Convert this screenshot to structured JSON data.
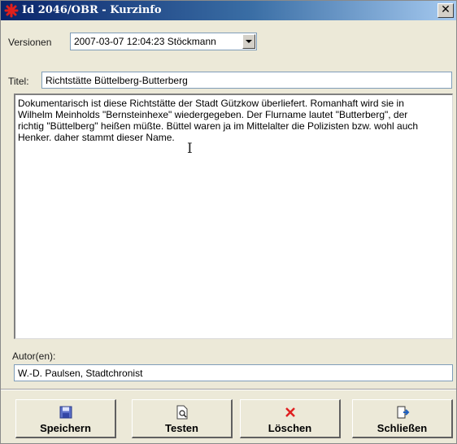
{
  "window": {
    "title": "Id 2046/OBR - Kurzinfo",
    "close_glyph": "✕",
    "app_icon": "red-star-icon",
    "accent": "#0a246a"
  },
  "version": {
    "label": "Versionen",
    "selected": "2007-03-07 12:04:23 Stöckmann"
  },
  "titel": {
    "label": "Titel:",
    "value": "Richtstätte Büttelberg-Butterberg"
  },
  "description": {
    "lines": [
      "Dokumentarisch ist diese Richtstätte der Stadt Gützkow überliefert. Romanhaft wird sie in",
      "Wilhelm Meinholds \"Bernsteinhexe\" wiedergegeben. Der Flurname lautet \"Butterberg\", der",
      "richtig \"Büttelberg\" heißen müßte. Büttel waren ja im Mittelalter die Polizisten bzw. wohl auch",
      "Henker. daher stammt dieser Name."
    ]
  },
  "autor": {
    "label": "Autor(en):",
    "value": "W.-D. Paulsen, Stadtchronist"
  },
  "buttons": {
    "save": {
      "label": "Speichern",
      "icon": "floppy-disk-icon"
    },
    "test": {
      "label": "Testen",
      "icon": "document-magnifier-icon"
    },
    "delete": {
      "label": "Löschen",
      "icon": "red-x-icon"
    },
    "close": {
      "label": "Schließen",
      "icon": "exit-door-icon"
    }
  }
}
